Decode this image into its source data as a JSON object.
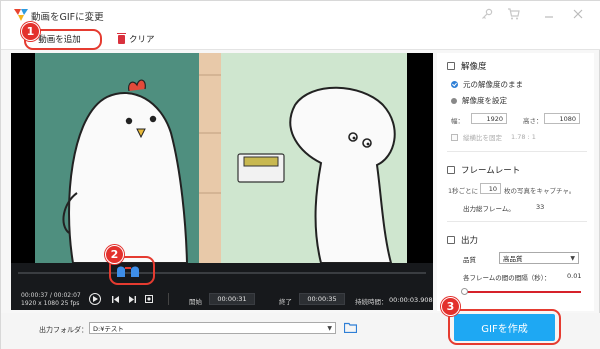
{
  "titlebar": {
    "title": "動画をGIFに変更"
  },
  "toolbar": {
    "add_label": "動画を追加",
    "clear_label": "クリア"
  },
  "callouts": {
    "one": "1",
    "two": "2",
    "three": "3"
  },
  "player": {
    "time_display": "00:00:37 / 00:02:07",
    "resolution_info": "1920 x 1080   25 fps",
    "start_label": "開始",
    "start_value": "00:00:31",
    "end_label": "終了",
    "end_value": "00:00:35",
    "duration_label": "持続時間：",
    "duration_value": "00:00:03.908"
  },
  "panel": {
    "resolution": {
      "title": "解像度",
      "keep_original": "元の解像度のまま",
      "set_resolution": "解像度を設定",
      "width_label": "幅：",
      "width_value": "1920",
      "height_label": "高さ：",
      "height_value": "1080",
      "aspect_label": "縦横比を固定",
      "aspect_value": "1.78 : 1"
    },
    "framerate": {
      "title": "フレームレート",
      "per_second_prefix": "1秒ごとに",
      "fps_value": "10",
      "per_second_suffix": "枚の写真をキャプチャ。",
      "total_label": "出力総フレーム。",
      "total_value": "33"
    },
    "output": {
      "title": "出力",
      "quality_label": "品質",
      "quality_value": "高品質",
      "interval_label": "各フレームの間の間隔（秒）：",
      "interval_value": "0.01"
    }
  },
  "bottom": {
    "folder_label": "出力フォルダ：",
    "folder_value": "D:¥テスト",
    "create_button": "GIFを作成"
  },
  "colors": {
    "accent": "#1ea8f3",
    "callout": "#e3312d"
  }
}
